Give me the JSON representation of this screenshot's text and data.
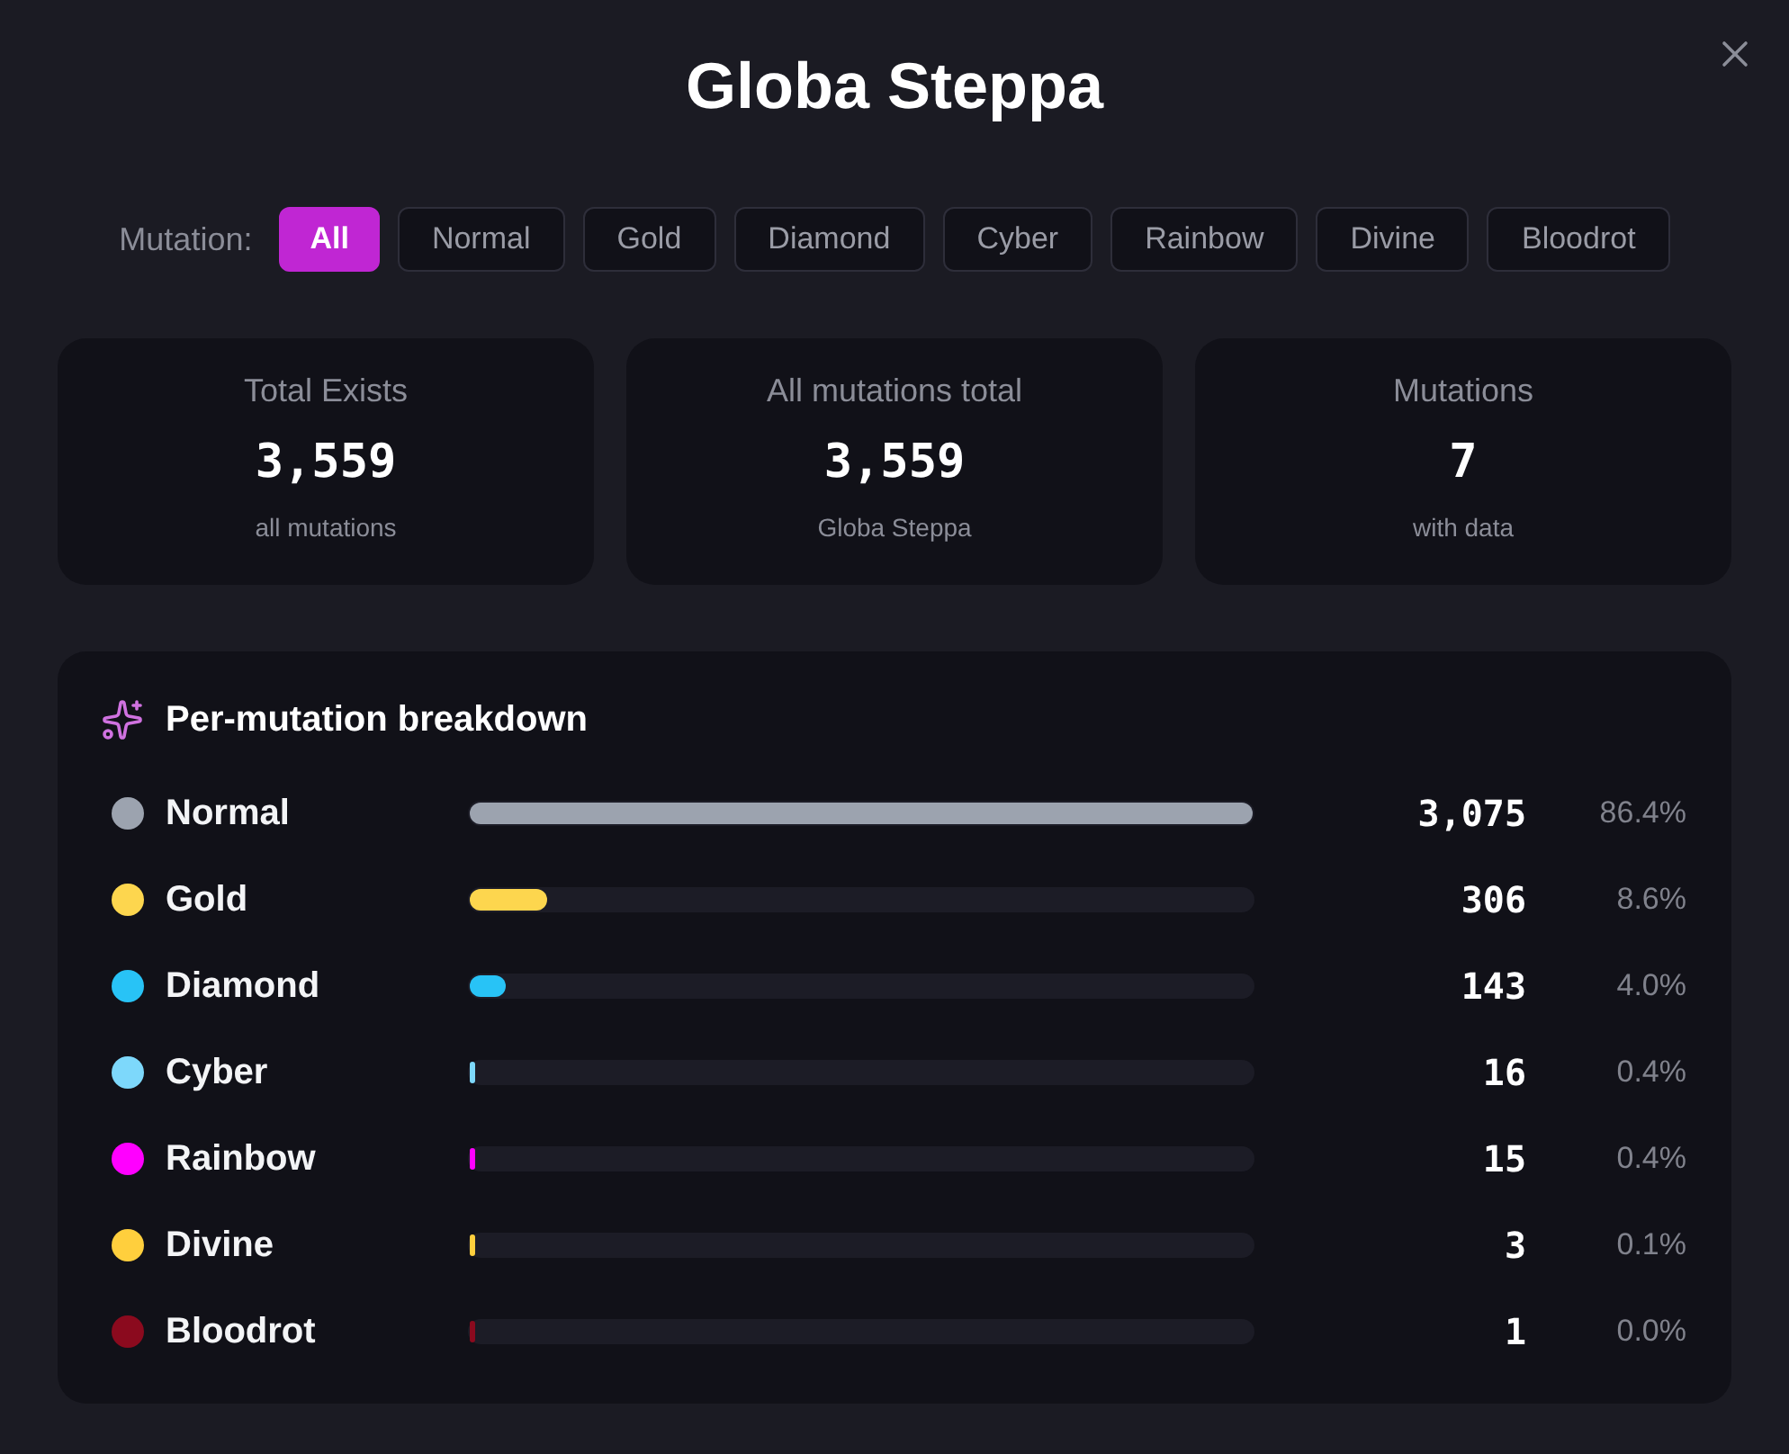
{
  "dialog": {
    "title": "Globa Steppa"
  },
  "filter": {
    "label": "Mutation:",
    "options": [
      {
        "label": "All",
        "selected": true
      },
      {
        "label": "Normal",
        "selected": false
      },
      {
        "label": "Gold",
        "selected": false
      },
      {
        "label": "Diamond",
        "selected": false
      },
      {
        "label": "Cyber",
        "selected": false
      },
      {
        "label": "Rainbow",
        "selected": false
      },
      {
        "label": "Divine",
        "selected": false
      },
      {
        "label": "Bloodrot",
        "selected": false
      }
    ]
  },
  "stats": [
    {
      "label": "Total Exists",
      "value": "3,559",
      "caption": "all mutations"
    },
    {
      "label": "All mutations total",
      "value": "3,559",
      "caption": "Globa Steppa"
    },
    {
      "label": "Mutations",
      "value": "7",
      "caption": "with data"
    }
  ],
  "breakdown": {
    "title": "Per-mutation breakdown",
    "rows": [
      {
        "name": "Normal",
        "color": "#9ca3af",
        "level": 1,
        "count": "3,075",
        "percent": "86.4%"
      },
      {
        "name": "Gold",
        "color": "#fdd64e",
        "level": 0.0995,
        "count": "306",
        "percent": "8.6%"
      },
      {
        "name": "Diamond",
        "color": "#28c3f6",
        "level": 0.0465,
        "count": "143",
        "percent": "4.0%"
      },
      {
        "name": "Cyber",
        "color": "#7dd8fb",
        "level": 0.0052,
        "count": "16",
        "percent": "0.4%"
      },
      {
        "name": "Rainbow",
        "color": "#ff00ff",
        "level": 0.0049,
        "count": "15",
        "percent": "0.4%"
      },
      {
        "name": "Divine",
        "color": "#ffcf3d",
        "level": 0.001,
        "count": "3",
        "percent": "0.1%"
      },
      {
        "name": "Bloodrot",
        "color": "#8b0a1e",
        "level": 0.0003,
        "count": "1",
        "percent": "0.0%"
      }
    ]
  }
}
